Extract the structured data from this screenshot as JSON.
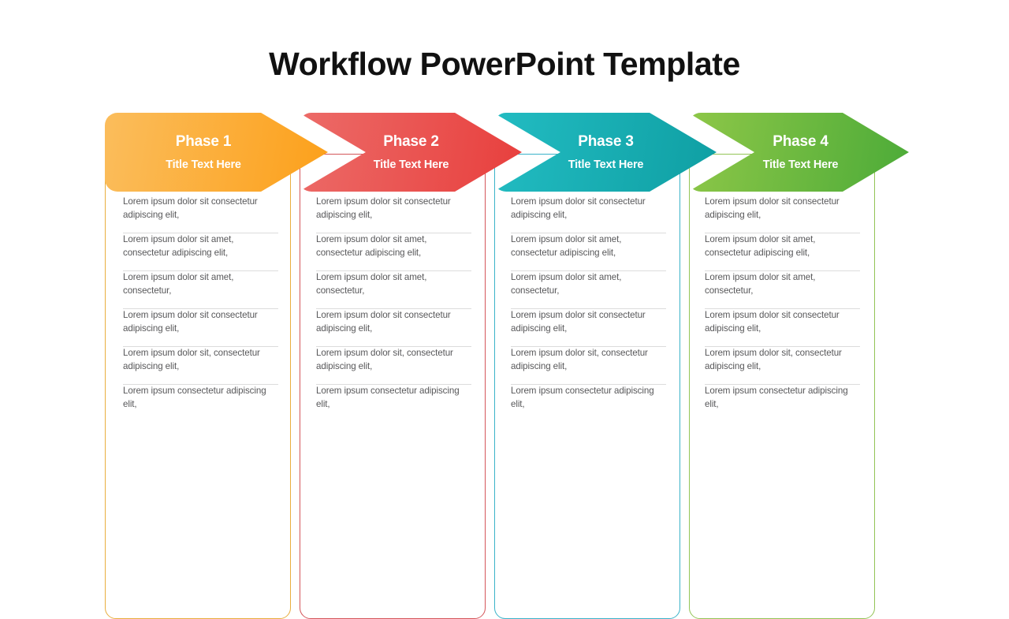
{
  "title": "Workflow PowerPoint Template",
  "colors": {
    "phase1_start": "#fbbd5c",
    "phase1_end": "#fca01a",
    "phase2_start": "#ec6b68",
    "phase2_end": "#e83f3d",
    "phase3_start": "#22bcc2",
    "phase3_end": "#0f9fa3",
    "phase4_start": "#8ec748",
    "phase4_end": "#4cab38",
    "title_text": "#111111",
    "body_text": "#58585a",
    "separator": "#dcdcdc"
  },
  "phases": [
    {
      "heading": "Phase 1",
      "subheading": "Title Text Here",
      "items": [
        "Lorem ipsum dolor sit consectetur adipiscing elit,",
        "Lorem ipsum dolor sit amet, consectetur adipiscing elit,",
        "Lorem ipsum dolor sit amet, consectetur,",
        "Lorem ipsum dolor sit consectetur adipiscing elit,",
        "Lorem ipsum dolor sit, consectetur adipiscing elit,",
        "Lorem ipsum consectetur adipiscing elit,"
      ]
    },
    {
      "heading": "Phase 2",
      "subheading": "Title Text Here",
      "items": [
        "Lorem ipsum dolor sit consectetur adipiscing elit,",
        "Lorem ipsum dolor sit amet, consectetur adipiscing elit,",
        "Lorem ipsum dolor sit amet, consectetur,",
        "Lorem ipsum dolor sit consectetur adipiscing elit,",
        "Lorem ipsum dolor sit, consectetur adipiscing elit,",
        "Lorem ipsum consectetur adipiscing elit,"
      ]
    },
    {
      "heading": "Phase 3",
      "subheading": "Title Text Here",
      "items": [
        "Lorem ipsum dolor sit consectetur adipiscing elit,",
        "Lorem ipsum dolor sit amet, consectetur adipiscing elit,",
        "Lorem ipsum dolor sit amet, consectetur,",
        "Lorem ipsum dolor sit consectetur adipiscing elit,",
        "Lorem ipsum dolor sit, consectetur adipiscing elit,",
        "Lorem ipsum consectetur adipiscing elit,"
      ]
    },
    {
      "heading": "Phase 4",
      "subheading": "Title Text Here",
      "items": [
        "Lorem ipsum dolor sit consectetur adipiscing elit,",
        "Lorem ipsum dolor sit amet, consectetur adipiscing elit,",
        "Lorem ipsum dolor sit amet, consectetur,",
        "Lorem ipsum dolor sit consectetur adipiscing elit,",
        "Lorem ipsum dolor sit, consectetur adipiscing elit,",
        "Lorem ipsum consectetur adipiscing elit,"
      ]
    }
  ]
}
